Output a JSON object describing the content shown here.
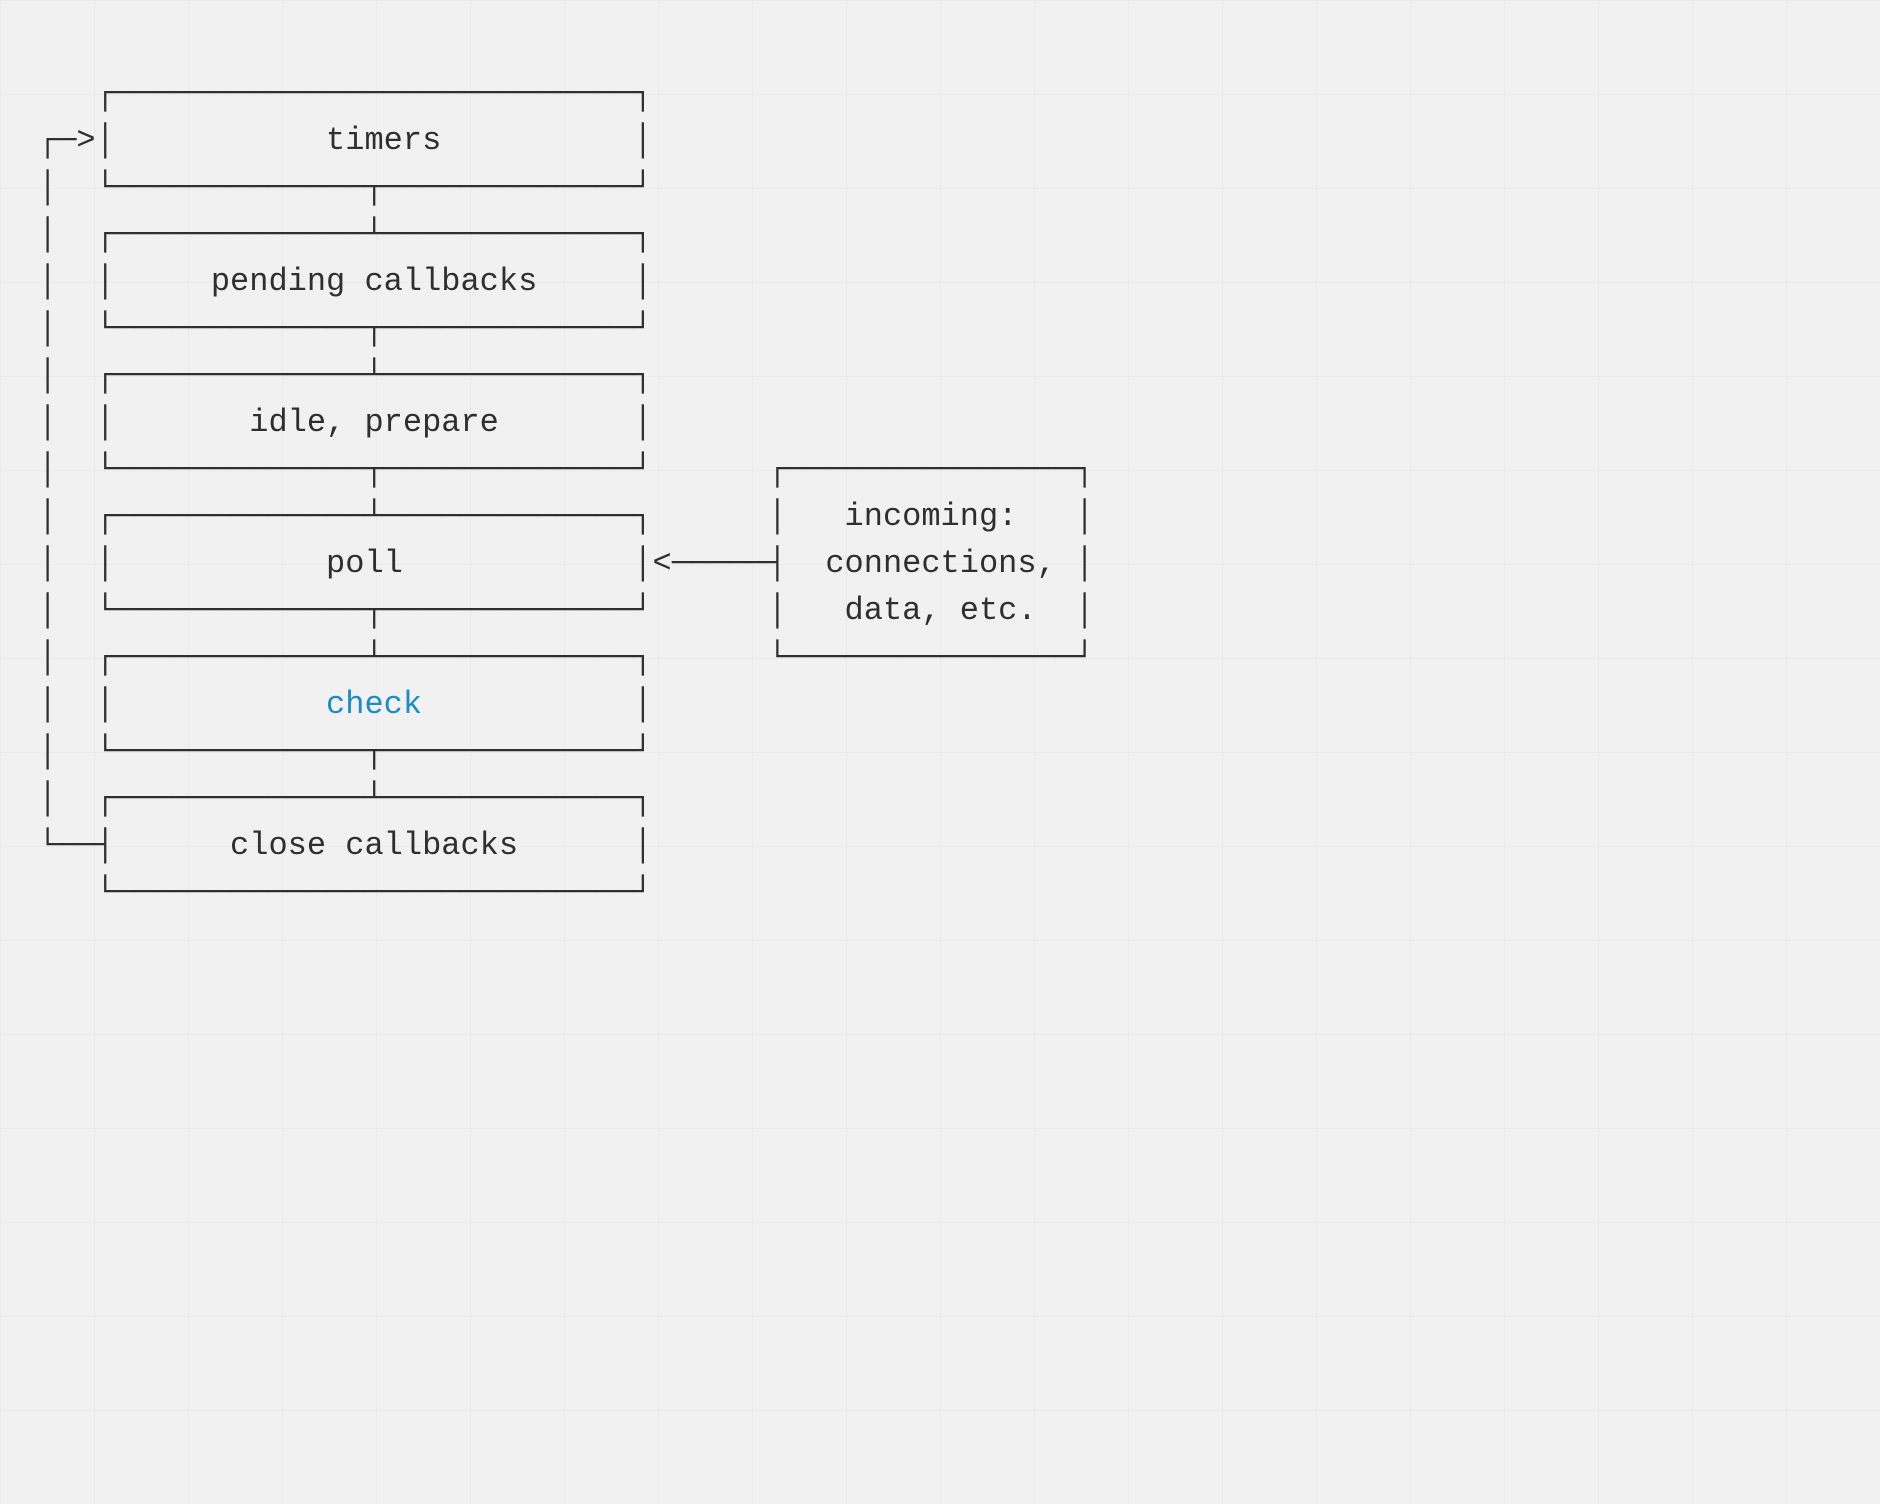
{
  "diagram": {
    "type": "event-loop-phases",
    "labels": {
      "timers": "timers",
      "pending_callbacks": "pending callbacks",
      "idle_prepare": "idle, prepare",
      "poll": "poll",
      "check": "check",
      "close_callbacks": "close callbacks",
      "incoming_line1": "incoming:",
      "incoming_line2": "connections,",
      "incoming_line3": "data, etc."
    },
    "highlight": "check",
    "colors": {
      "text": "#2f2f2f",
      "highlight": "#1a8cc8",
      "background": "#f1f1f1"
    }
  }
}
